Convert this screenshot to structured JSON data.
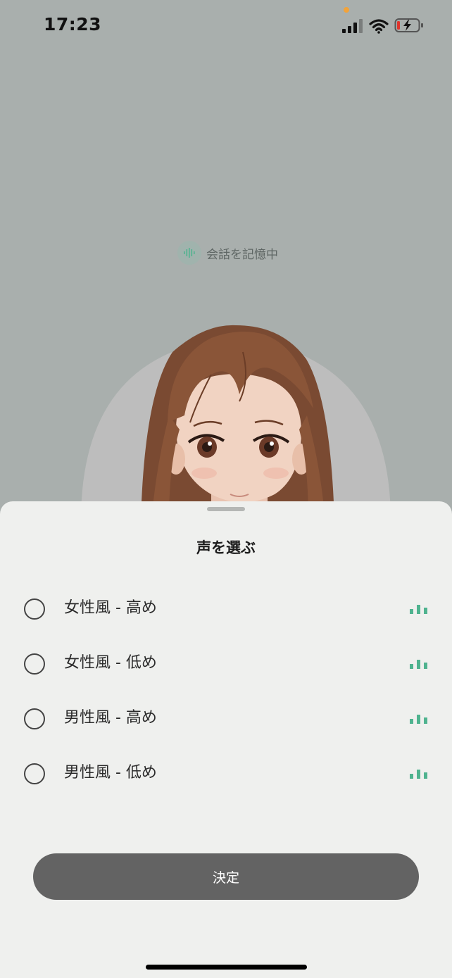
{
  "status_bar": {
    "time": "17:23"
  },
  "memory_indicator": {
    "label": "会話を記憶中"
  },
  "sheet": {
    "title": "声を選ぶ",
    "options": [
      {
        "label": "女性風 - 高め"
      },
      {
        "label": "女性風 - 低め"
      },
      {
        "label": "男性風 - 高め"
      },
      {
        "label": "男性風 - 低め"
      }
    ],
    "confirm_label": "決定"
  },
  "colors": {
    "background": "#a9afad",
    "sheet": "#eff0ee",
    "accent_green": "#4fb38f",
    "confirm_button": "#636363"
  }
}
